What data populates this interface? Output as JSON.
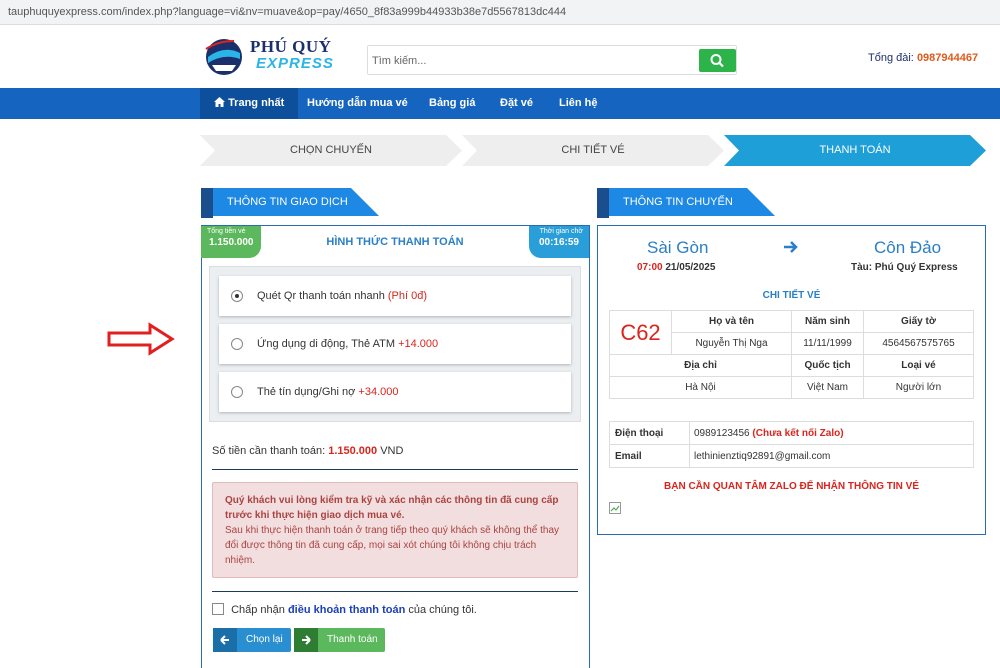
{
  "browser": {
    "url": "tauphuquyexpress.com/index.php?language=vi&nv=muave&op=pay/4650_8f83a999b44933b38e7d5567813dc444"
  },
  "header": {
    "logo_line1": "PHÚ QUÝ",
    "logo_line2": "EXPRESS",
    "search_placeholder": "Tìm kiếm...",
    "hotline_label": "Tổng đài:",
    "hotline_number": "0987944467"
  },
  "nav": {
    "items": [
      "Trang nhất",
      "Hướng dẫn mua vé",
      "Bảng giá",
      "Đặt vé",
      "Liên hệ"
    ]
  },
  "steps": [
    "CHỌN CHUYẾN",
    "CHI TIẾT VÉ",
    "THANH TOÁN"
  ],
  "transaction": {
    "tab": "THÔNG TIN GIAO DỊCH",
    "total_label": "Tổng tiền vé",
    "total": "1.150.000",
    "method_title": "HÌNH THỨC THANH TOÁN",
    "timer_label": "Thời gian chờ",
    "timer": "00:16:59",
    "options": [
      {
        "label": "Quét Qr thanh toán nhanh",
        "fee": "(Phí 0đ)",
        "selected": true
      },
      {
        "label": "Ứng dụng di động, Thẻ ATM",
        "fee": "+14.000",
        "selected": false
      },
      {
        "label": "Thẻ tín dụng/Ghi nợ",
        "fee": "+34.000",
        "selected": false
      }
    ],
    "amount_label": "Số tiền cần thanh toán:",
    "amount": "1.150.000",
    "currency": "VND",
    "warning_bold": "Quý khách vui lòng kiểm tra kỹ và xác nhận các thông tin đã cung cấp trước khi thực hiện giao dịch mua vé.",
    "warning_text": "Sau khi thực hiện thanh toán ở trang tiếp theo quý khách sẽ không thể thay đổi được thông tin đã cung cấp, mọi sai xót chúng tôi không chịu trách nhiệm.",
    "terms_prefix": "Chấp nhận",
    "terms_link": "điều khoản thanh toán",
    "terms_suffix": "của chúng tôi.",
    "back_button": "Chọn lại",
    "pay_button": "Thanh toán"
  },
  "trip": {
    "tab": "THÔNG TIN CHUYẾN",
    "from": "Sài Gòn",
    "to": "Côn Đảo",
    "time": "07:00",
    "date": "21/05/2025",
    "vessel": "Tàu: Phú Quý Express",
    "detail_title": "CHI TIẾT VÉ",
    "seat": "C62",
    "ticket_headers": [
      "Họ và tên",
      "Năm sinh",
      "Giấy tờ",
      "Địa chỉ",
      "Quốc tịch",
      "Loại vé"
    ],
    "ticket_values": [
      "Nguyễn Thị Nga",
      "11/11/1999",
      "4564567575765",
      "Hà Nội",
      "Việt Nam",
      "Người lớn"
    ],
    "phone_label": "Điện thoại",
    "phone": "0989123456",
    "zalo_note": "(Chưa kết nối Zalo)",
    "email_label": "Email",
    "email": "lethinienztiq92891@gmail.com",
    "zalo_notice": "BẠN CẦN QUAN TÂM ZALO ĐỂ NHẬN THÔNG TIN VÉ"
  },
  "colors": {
    "primary": "#1565c0",
    "accent_green": "#2cb34a",
    "alert_red": "#d9251d",
    "arrow_annotation": "#e02020"
  }
}
